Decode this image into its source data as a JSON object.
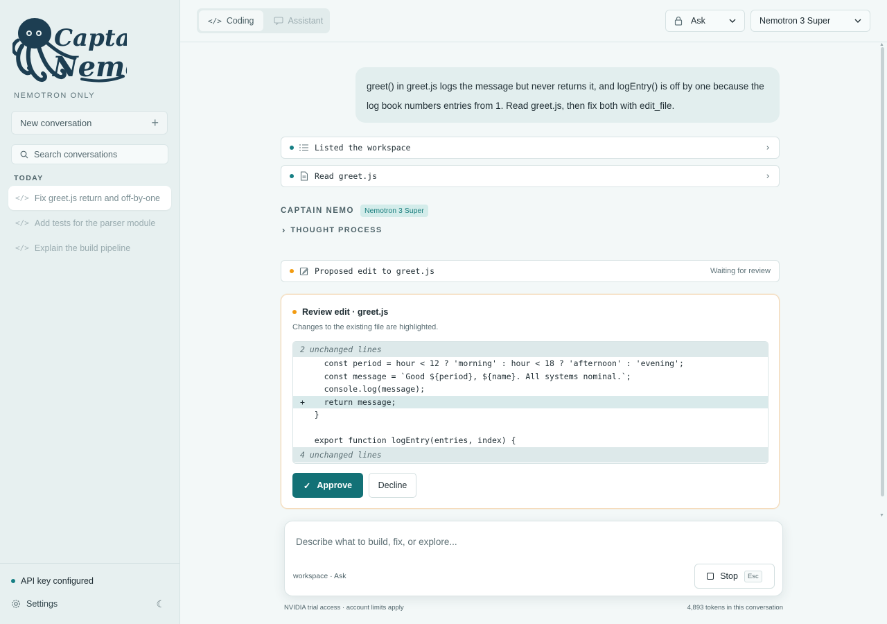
{
  "app": {
    "logo_text": "Captain Nemo",
    "logo_subtitle": "NEMOTRON ONLY"
  },
  "sidebar": {
    "new_conversation": "New conversation",
    "search_placeholder": "Search conversations",
    "section_today": "TODAY",
    "conversations": [
      {
        "label": "Fix greet.js return and off-by-one",
        "active": true
      },
      {
        "label": "Add tests for the parser module",
        "active": false
      },
      {
        "label": "Explain the build pipeline",
        "active": false
      }
    ],
    "api_status": "API key configured",
    "settings": "Settings"
  },
  "topbar": {
    "tabs": [
      {
        "label": "Coding",
        "icon": "code-icon",
        "active": true
      },
      {
        "label": "Assistant",
        "icon": "chat-icon",
        "active": false
      }
    ],
    "permission_mode": "Ask",
    "model": "Nemotron 3 Super"
  },
  "chat": {
    "user_message": "greet() in greet.js logs the message but never returns it, and logEntry() is off by one because the log book numbers entries from 1. Read greet.js, then fix both with edit_file.",
    "tool_calls": [
      {
        "label": "Listed the workspace",
        "icon": "list-icon"
      },
      {
        "label": "Read greet.js",
        "icon": "file-icon"
      }
    ],
    "assistant_name": "CAPTAIN NEMO",
    "assistant_model_badge": "Nemotron 3 Super",
    "thought_process": "THOUGHT PROCESS",
    "proposed_edit": {
      "label": "Proposed edit to greet.js",
      "status": "Waiting for review"
    },
    "review": {
      "title": "Review edit · greet.js",
      "subtitle": "Changes to the existing file are highlighted.",
      "fold_top": "2 unchanged lines",
      "lines": [
        {
          "prefix": " ",
          "text": "  const period = hour < 12 ? 'morning' : hour < 18 ? 'afternoon' : 'evening';",
          "type": "context"
        },
        {
          "prefix": " ",
          "text": "  const message = `Good ${period}, ${name}. All systems nominal.`;",
          "type": "context"
        },
        {
          "prefix": " ",
          "text": "  console.log(message);",
          "type": "context"
        },
        {
          "prefix": "+",
          "text": "  return message;",
          "type": "add"
        },
        {
          "prefix": " ",
          "text": "}",
          "type": "context"
        },
        {
          "prefix": " ",
          "text": "",
          "type": "context"
        },
        {
          "prefix": " ",
          "text": "export function logEntry(entries, index) {",
          "type": "context"
        }
      ],
      "fold_bottom": "4 unchanged lines",
      "approve": "Approve",
      "decline": "Decline"
    }
  },
  "composer": {
    "placeholder": "Describe what to build, fix, or explore...",
    "meta": "workspace · Ask",
    "stop": "Stop",
    "stop_key": "Esc"
  },
  "footer": {
    "left": "NVIDIA trial access · account limits apply",
    "right": "4,893 tokens in this conversation"
  },
  "colors": {
    "accent": "#137176",
    "status_dot": "#167f84",
    "pending_dot": "#f29b10"
  }
}
